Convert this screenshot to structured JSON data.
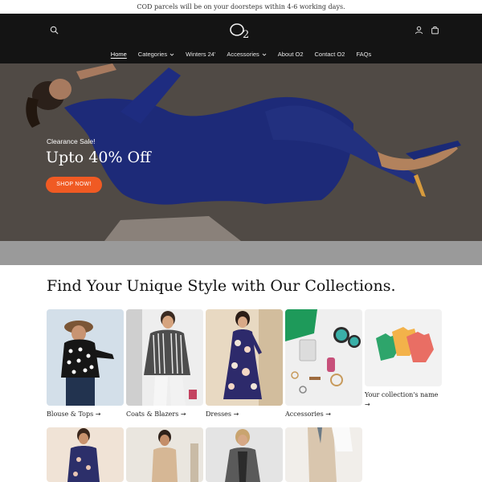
{
  "announcement": "COD parcels will be on your doorsteps within 4-6 working days.",
  "header": {
    "logo_text": "O2",
    "icons": [
      "search-icon",
      "account-icon",
      "cart-icon"
    ],
    "nav": [
      {
        "label": "Home",
        "active": true,
        "dropdown": false
      },
      {
        "label": "Categories",
        "active": false,
        "dropdown": true
      },
      {
        "label": "Winters 24'",
        "active": false,
        "dropdown": false
      },
      {
        "label": "Accessories",
        "active": false,
        "dropdown": true
      },
      {
        "label": "About O2",
        "active": false,
        "dropdown": false
      },
      {
        "label": "Contact O2",
        "active": false,
        "dropdown": false
      },
      {
        "label": "FAQs",
        "active": false,
        "dropdown": false
      }
    ]
  },
  "hero": {
    "subtitle": "Clearance Sale!",
    "title": "Upto 40% Off",
    "button_label": "SHOP NOW!",
    "button_color": "#f05a23"
  },
  "collections": {
    "title": "Find Your Unique Style with Our Collections.",
    "row1": [
      {
        "label": "Blouse & Tops",
        "arrow": "→"
      },
      {
        "label": "Coats & Blazers",
        "arrow": "→"
      },
      {
        "label": "Dresses",
        "arrow": "→"
      },
      {
        "label": "Accessories",
        "arrow": "→"
      },
      {
        "label": "Your collection's name",
        "arrow": "→"
      }
    ]
  }
}
